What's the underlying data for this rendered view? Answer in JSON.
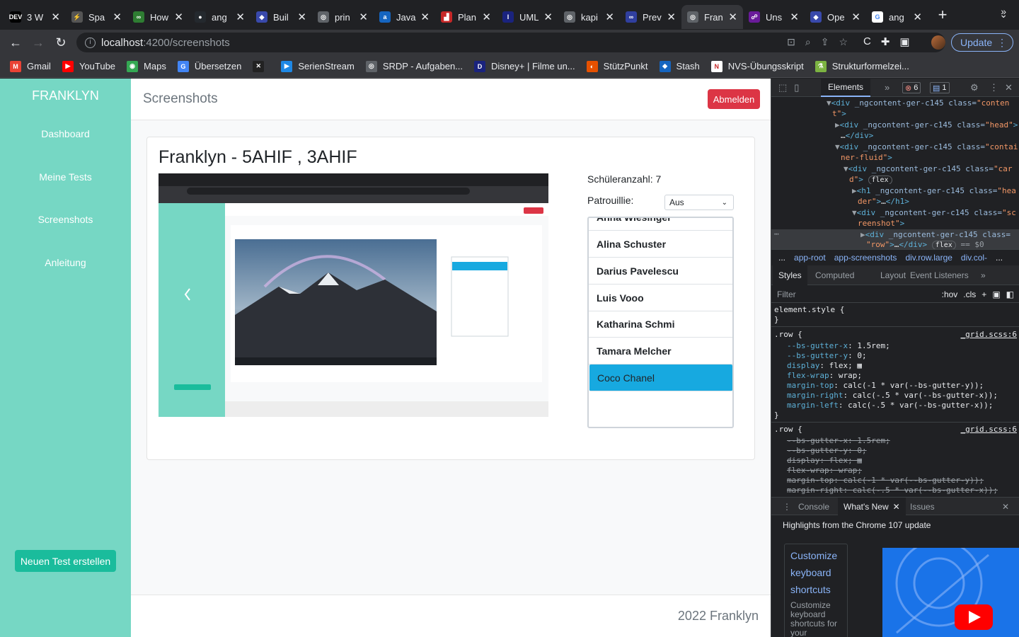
{
  "browser": {
    "tabs": [
      {
        "label": "3 W",
        "icon": "dev-icon",
        "color": "#000000",
        "glyph": "DEV"
      },
      {
        "label": "Spa",
        "icon": "bolt-icon",
        "color": "#555555",
        "glyph": "⚡"
      },
      {
        "label": "How",
        "icon": "infinity-icon",
        "color": "#2e7d32",
        "glyph": "∞"
      },
      {
        "label": "ang",
        "icon": "github-icon",
        "color": "#24292e",
        "glyph": "●"
      },
      {
        "label": "Buil",
        "icon": "app-icon",
        "color": "#3949ab",
        "glyph": "◆"
      },
      {
        "label": "prin",
        "icon": "globe-icon",
        "color": "#5f6368",
        "glyph": "◎"
      },
      {
        "label": "Java",
        "icon": "a-icon",
        "color": "#1565c0",
        "glyph": "a"
      },
      {
        "label": "Plan",
        "icon": "plan-icon",
        "color": "#c62828",
        "glyph": "▟"
      },
      {
        "label": "UML",
        "icon": "uml-icon",
        "color": "#1a237e",
        "glyph": "I"
      },
      {
        "label": "kapi",
        "icon": "globe-icon",
        "color": "#5f6368",
        "glyph": "◎"
      },
      {
        "label": "Prev",
        "icon": "loop-icon",
        "color": "#303f9f",
        "glyph": "∞"
      },
      {
        "label": "Fran",
        "icon": "franklyn-icon",
        "color": "#5f6368",
        "glyph": "◎",
        "active": true
      },
      {
        "label": "Uns",
        "icon": "unsplash-icon",
        "color": "#6a1b9a",
        "glyph": "☍"
      },
      {
        "label": "Ope",
        "icon": "app-icon",
        "color": "#3949ab",
        "glyph": "◆"
      },
      {
        "label": "ang",
        "icon": "google-icon",
        "color": "#ffffff",
        "glyph": "G"
      }
    ],
    "url_host": "localhost",
    "url_path": ":4200/screenshots",
    "update_label": "Update",
    "bookmarks": [
      {
        "label": "Gmail",
        "icon": "gmail-icon",
        "color": "#ea4335",
        "glyph": "M"
      },
      {
        "label": "YouTube",
        "icon": "youtube-icon",
        "color": "#ff0000",
        "glyph": "▶"
      },
      {
        "label": "Maps",
        "icon": "maps-icon",
        "color": "#34a853",
        "glyph": "◉"
      },
      {
        "label": "Übersetzen",
        "icon": "translate-icon",
        "color": "#4285f4",
        "glyph": "G"
      },
      {
        "label": "",
        "icon": "x-icon",
        "color": "#222222",
        "glyph": "✕"
      },
      {
        "label": "SerienStream",
        "icon": "serienstream-icon",
        "color": "#1e88e5",
        "glyph": "▶"
      },
      {
        "label": "SRDP - Aufgaben...",
        "icon": "globe-icon",
        "color": "#5f6368",
        "glyph": "◎"
      },
      {
        "label": "Disney+ | Filme un...",
        "icon": "disney-icon",
        "color": "#1a237e",
        "glyph": "D"
      },
      {
        "label": "StützPunkt",
        "icon": "stuetzpunkt-icon",
        "color": "#e65100",
        "glyph": "◐"
      },
      {
        "label": "Stash",
        "icon": "stash-icon",
        "color": "#1565c0",
        "glyph": "◆"
      },
      {
        "label": "NVS-Übungsskript",
        "icon": "nvs-icon",
        "color": "#ffffff",
        "glyph": "N"
      },
      {
        "label": "Strukturformelzei...",
        "icon": "molecule-icon",
        "color": "#7cb342",
        "glyph": "⚗"
      }
    ]
  },
  "app": {
    "brand": "FRANKLYN",
    "nav": [
      "Dashboard",
      "Meine Tests",
      "Screenshots",
      "Anleitung"
    ],
    "new_test_label": "Neuen Test erstellen",
    "header_title": "Screenshots",
    "logout_label": "Abmelden",
    "card_title": "Franklyn - 5AHIF , 3AHIF",
    "student_count_label": "Schüleranzahl: 7",
    "patrol_label": "Patrouillie:",
    "patrol_value": "Aus",
    "students": [
      "Anna Wiesinger",
      "Alina Schuster",
      "Darius Pavelescu",
      "Luis Vooo",
      "Katharina Schmi",
      "Tamara Melcher",
      "Coco Chanel"
    ],
    "selected_student": "Coco Chanel",
    "footer": "2022 Franklyn"
  },
  "devtools": {
    "tabs": [
      "Elements"
    ],
    "error_count": "6",
    "message_count": "1",
    "breadcrumbs": [
      "...",
      "app-root",
      "app-screenshots",
      "div.row.large",
      "div.col-",
      "..."
    ],
    "style_tabs": [
      "Styles",
      "Computed",
      "Layout",
      "Event Listeners"
    ],
    "filter_placeholder": "Filter",
    "filter_hov": ":hov",
    "filter_cls": ".cls",
    "element_style": "element.style {",
    "rule_selector": ".row {",
    "rule_source": "_grid.scss:6",
    "drawer_tabs": [
      "Console",
      "What's New",
      "Issues"
    ],
    "whats_new_heading": "Highlights from the Chrome 107 update",
    "whats_new_links": [
      "Customize",
      "keyboard",
      "shortcuts"
    ],
    "whats_new_desc": "Customize keyboard shortcuts for your favourite"
  }
}
